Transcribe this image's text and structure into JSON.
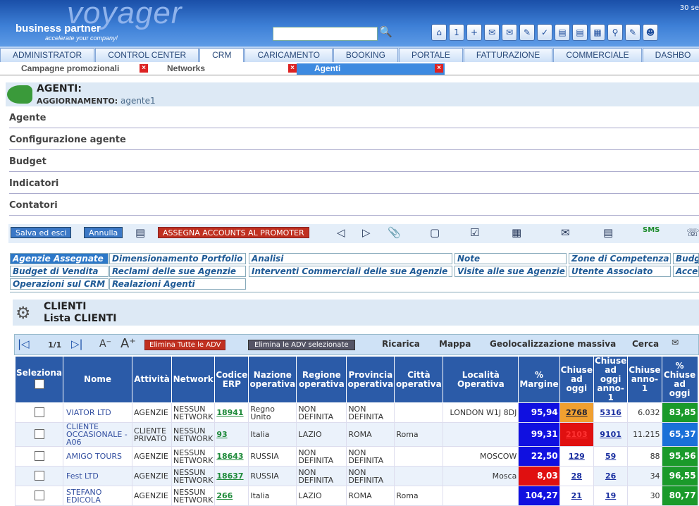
{
  "header": {
    "logo_big": "voyager",
    "logo_brand": "business partner",
    "logo_tag": "accelerate your company!",
    "date": "30 se",
    "search_value": ""
  },
  "tabs": [
    "ADMINISTRATOR",
    "CONTROL CENTER",
    "CRM",
    "CARICAMENTO",
    "BOOKING",
    "PORTALE",
    "FATTURAZIONE",
    "COMMERCIALE",
    "DASHBO"
  ],
  "subtabs": [
    "Campagne promozionali",
    "Networks",
    "Agenti"
  ],
  "title": {
    "main": "AGENTI:",
    "update_label": "AGGIORNAMENTO:",
    "update_value": "agente1"
  },
  "sections": [
    "Agente",
    "Configurazione agente",
    "Budget",
    "Indicatori",
    "Contatori"
  ],
  "toolbar": {
    "save": "Salva ed esci",
    "cancel": "Annulla",
    "assign": "ASSEGNA ACCOUNTS AL PROMOTER",
    "sms": "SMS"
  },
  "subpanels": [
    "Agenzie Assegnate",
    "Dimensionamento Portfolio",
    "Analisi",
    "Note",
    "Zone di Competenza",
    "Budg",
    "Budget di Vendita",
    "Reclami delle sue Agenzie",
    "Interventi Commerciali delle sue Agenzie",
    "Visite alle sue Agenzie",
    "Utente Associato",
    "Acce",
    "Operazioni sul CRM",
    "Realazioni Agenti"
  ],
  "clienti": {
    "title": "CLIENTI",
    "subtitle": "Lista CLIENTI"
  },
  "grid": {
    "page": "1/1",
    "del_all": "Elimina Tutte le ADV",
    "del_sel": "Elimina le ADV selezionate",
    "reload": "Ricarica",
    "map": "Mappa",
    "geo": "Geolocalizzazione massiva",
    "search": "Cerca"
  },
  "columns": [
    "Seleziona",
    "Nome",
    "Attività",
    "Network",
    "Codice ERP",
    "Nazione operativa",
    "Regione operativa",
    "Provincia operativa",
    "Città operativa",
    "Località Operativa",
    "% Margine",
    "Chiuse ad oggi",
    "Chiuse ad oggi anno-1",
    "Chiuse anno-1",
    "% Chiuse ad oggi"
  ],
  "rows": [
    {
      "nome": "VIATOR LTD",
      "att": "AGENZIE",
      "net": "NESSUN NETWORK",
      "erp": "18941",
      "naz": "Regno Unito",
      "reg": "NON DEFINITA",
      "prov": "NON DEFINITA",
      "citta": "",
      "loc": "LONDON W1J 8DJ",
      "marg": "95,94",
      "mc": "#1010e0",
      "chiu": "2768",
      "cc": "#f0a030",
      "cf": "#223",
      "chiu1": "5316",
      "ca": "6.032",
      "pct": "83,85",
      "pc": "#1a9a2a"
    },
    {
      "nome": "CLIENTE OCCASIONALE - A06",
      "att": "CLIENTE PRIVATO",
      "net": "NESSUN NETWORK",
      "erp": "93",
      "naz": "Italia",
      "reg": "LAZIO",
      "prov": "ROMA",
      "citta": "Roma",
      "loc": "",
      "marg": "99,31",
      "mc": "#1010e0",
      "chiu": "2103",
      "cc": "#e01010",
      "cf": "#f33",
      "chiu1": "9101",
      "ca": "11.215",
      "pct": "65,37",
      "pc": "#1a70d8"
    },
    {
      "nome": "AMIGO TOURS",
      "att": "AGENZIE",
      "net": "NESSUN NETWORK",
      "erp": "18643",
      "naz": "RUSSIA",
      "reg": "NON DEFINITA",
      "prov": "NON DEFINITA",
      "citta": "",
      "loc": "MOSCOW",
      "marg": "22,50",
      "mc": "#1010e0",
      "chiu": "129",
      "cc": "",
      "cf": "#1a2fa0",
      "chiu1": "59",
      "ca": "88",
      "pct": "95,56",
      "pc": "#1a9a2a"
    },
    {
      "nome": "Fest LTD",
      "att": "AGENZIE",
      "net": "NESSUN NETWORK",
      "erp": "18637",
      "naz": "RUSSIA",
      "reg": "NON DEFINITA",
      "prov": "NON DEFINITA",
      "citta": "",
      "loc": "Mosca",
      "marg": "8,03",
      "mc": "#e01010",
      "chiu": "28",
      "cc": "",
      "cf": "#1a2fa0",
      "chiu1": "26",
      "ca": "34",
      "pct": "96,55",
      "pc": "#1a9a2a"
    },
    {
      "nome": "STEFANO EDICOLA",
      "att": "AGENZIE",
      "net": "NESSUN NETWORK",
      "erp": "266",
      "naz": "Italia",
      "reg": "LAZIO",
      "prov": "ROMA",
      "citta": "Roma",
      "loc": "",
      "marg": "104,27",
      "mc": "#1010e0",
      "chiu": "21",
      "cc": "",
      "cf": "#1a2fa0",
      "chiu1": "19",
      "ca": "30",
      "pct": "80,77",
      "pc": "#1a9a2a"
    }
  ]
}
